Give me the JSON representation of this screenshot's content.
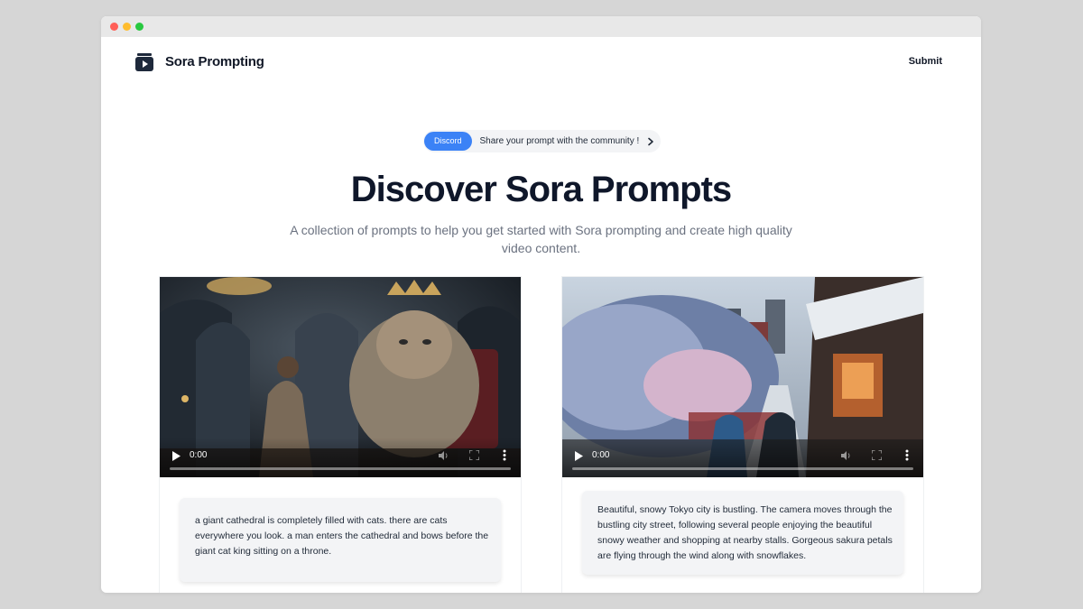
{
  "nav": {
    "brand": "Sora Prompting",
    "submit_label": "Submit"
  },
  "announcement": {
    "badge": "Discord",
    "text": "Share your prompt with the community !"
  },
  "hero": {
    "title": "Discover Sora Prompts",
    "subtitle": "A collection of prompts to help you get started with Sora prompting and create high quality video content."
  },
  "cards": [
    {
      "time": "0:00",
      "prompt": "a giant cathedral is completely filled with cats. there are cats everywhere you look. a man enters the cathedral and bows before the giant cat king sitting on a throne."
    },
    {
      "time": "0:00",
      "prompt": "Beautiful, snowy Tokyo city is bustling. The camera moves through the bustling city street, following several people enjoying the beautiful snowy weather and shopping at nearby stalls. Gorgeous sakura petals are flying through the wind along with snowflakes."
    }
  ],
  "icons": {
    "logo": "video-play-icon",
    "pill_chevron": "chevron-right-icon",
    "play": "play-icon",
    "mute": "volume-icon",
    "fullscreen": "fullscreen-icon",
    "more": "more-vertical-icon"
  },
  "colors": {
    "accent": "#3b82f6",
    "heading": "#0f172a",
    "muted_text": "#6b7280",
    "pill_bg": "#f3f4f6"
  }
}
